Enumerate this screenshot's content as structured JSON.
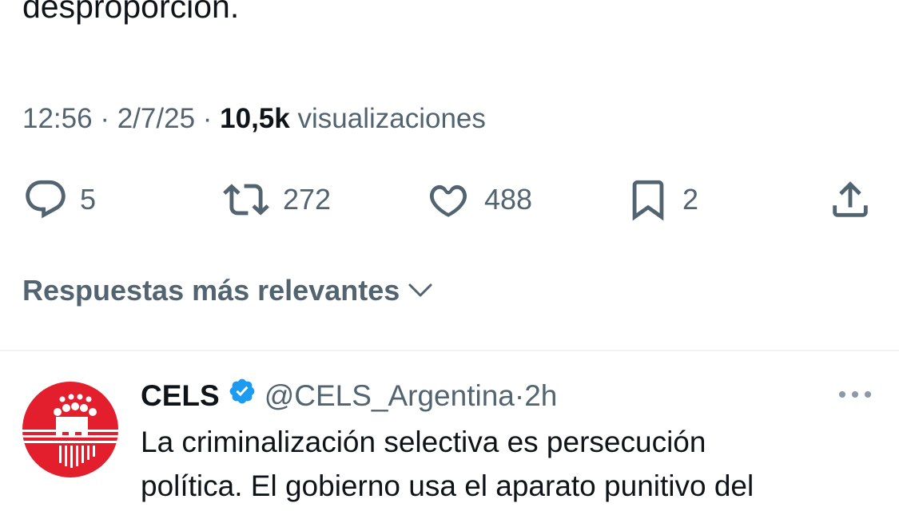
{
  "tweet": {
    "text_tail": "desproporción.",
    "time": "12:56",
    "separator": "·",
    "date": "2/7/25",
    "views_count": "10,5k",
    "views_label": "visualizaciones"
  },
  "actions": {
    "replies": {
      "icon": "reply-icon",
      "count": "5"
    },
    "retweets": {
      "icon": "retweet-icon",
      "count": "272"
    },
    "likes": {
      "icon": "heart-icon",
      "count": "488"
    },
    "bookmarks": {
      "icon": "bookmark-icon",
      "count": "2"
    },
    "share": {
      "icon": "share-icon"
    }
  },
  "sort": {
    "label": "Respuestas más relevantes",
    "icon": "chevron-down-icon"
  },
  "reply": {
    "name": "CELS",
    "verified_icon": "verified-badge-icon",
    "handle": "@CELS_Argentina",
    "separator": "·",
    "time": "2h",
    "more_icon": "more-options-icon",
    "text_line1": "La criminalización selectiva es persecución",
    "text_line2": "política. El gobierno usa el aparato punitivo del",
    "avatar_color": "#e31e2d"
  },
  "colors": {
    "text_primary": "#0f1419",
    "text_secondary": "#536471",
    "verified_blue": "#1d9bf0",
    "divider": "#eff3f4"
  }
}
